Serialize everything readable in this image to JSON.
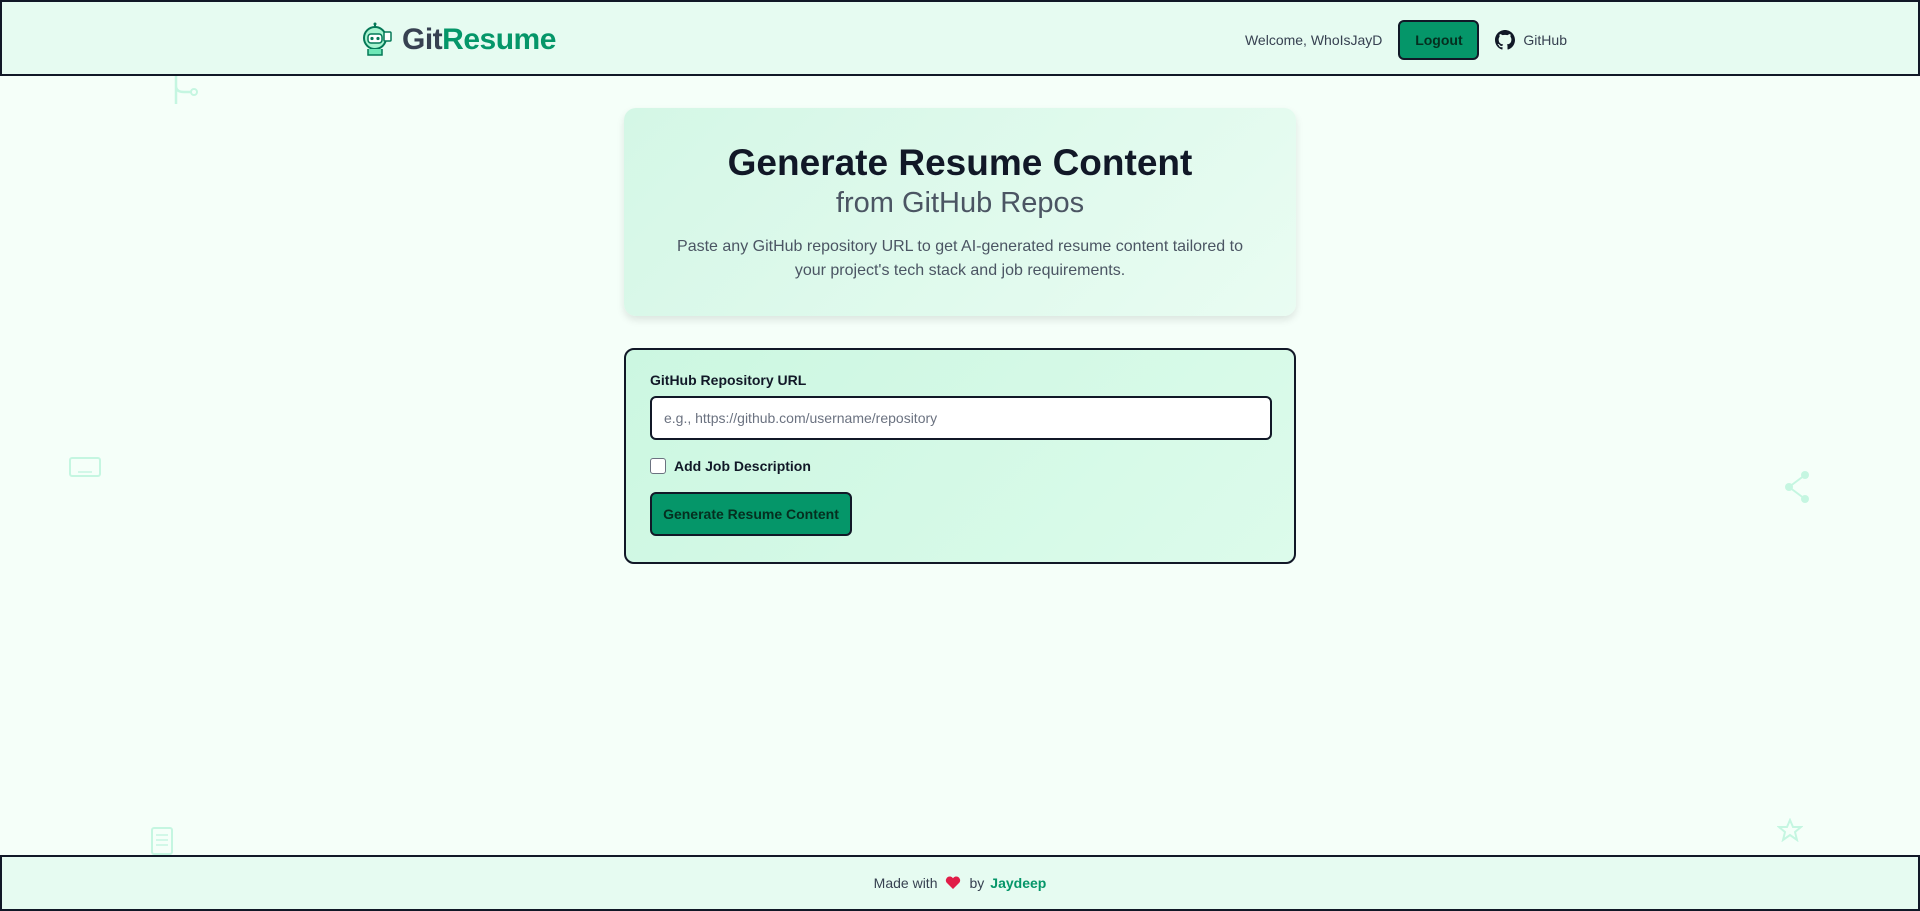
{
  "header": {
    "logo_git": "Git",
    "logo_resume": "Resume",
    "welcome": "Welcome, WhoIsJayD",
    "logout_label": "Logout",
    "github_label": "GitHub"
  },
  "hero": {
    "title": "Generate Resume Content",
    "subtitle": "from GitHub Repos",
    "description": "Paste any GitHub repository URL to get AI-generated resume content tailored to your project's tech stack and job requirements."
  },
  "form": {
    "url_label": "GitHub Repository URL",
    "url_value": "",
    "url_placeholder": "e.g., https://github.com/username/repository",
    "job_description_label": "Add Job Description",
    "job_description_checked": false,
    "generate_label": "Generate Resume Content"
  },
  "footer": {
    "made_with": "Made with",
    "by": "by",
    "author": "Jaydeep"
  },
  "colors": {
    "accent": "#059669",
    "background": "#f5fff9",
    "header_bg": "#e6fbf1",
    "heart": "#e11d48"
  },
  "icons": {
    "logo": "robot-mascot-icon",
    "github": "github-icon",
    "heart": "heart-icon"
  }
}
